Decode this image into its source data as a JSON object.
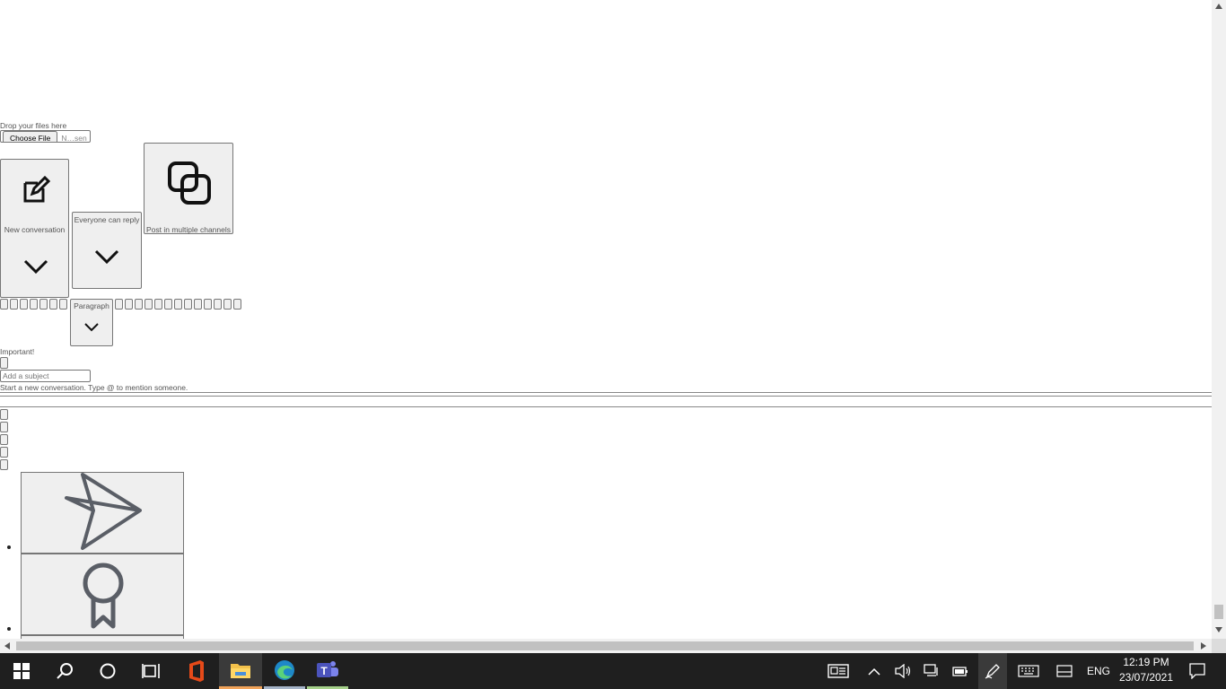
{
  "compose": {
    "drop_label": "Drop your files here",
    "new_conversation_label": "New conversation",
    "reply_setting_label": "Everyone can reply",
    "multi_channel_label": "Post in multiple channels",
    "paragraph_label": "Paragraph",
    "important_label": "Important!",
    "subject_placeholder": "Add a subject",
    "message_placeholder": "Start a new conversation. Type @ to mention someone."
  },
  "taskbar": {
    "apps": [
      "windows-start",
      "search",
      "cortana",
      "task-view",
      "office",
      "file-explorer",
      "edge",
      "teams"
    ],
    "language": "ENG",
    "time": "12:19 PM",
    "date": "23/07/2021"
  }
}
